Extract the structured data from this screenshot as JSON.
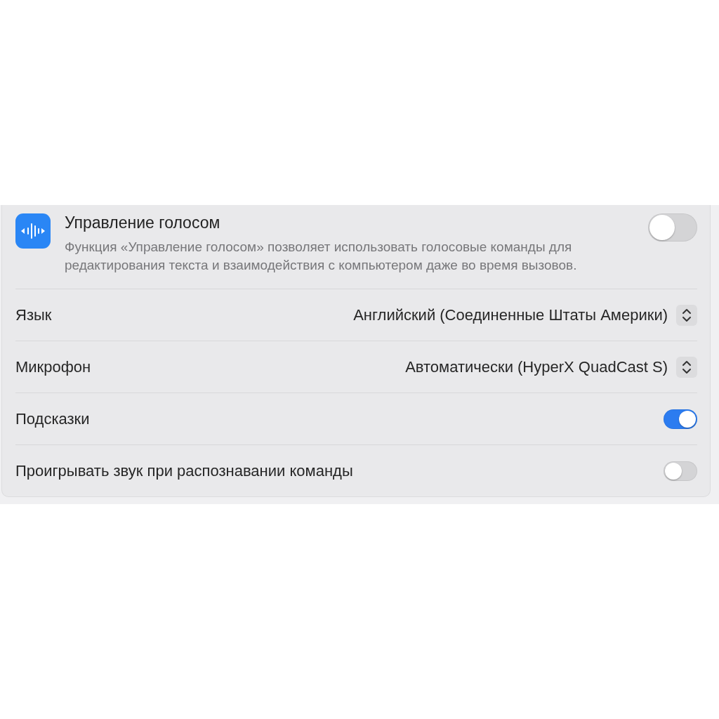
{
  "header": {
    "title": "Управление голосом",
    "description": "Функция «Управление голосом» позволяет использовать голосовые команды для редактирования текста и взаимодействия с компьютером даже во время вызовов.",
    "on": false
  },
  "rows": [
    {
      "kind": "popup",
      "label": "Язык",
      "value": "Английский (Соединенные Штаты Америки)"
    },
    {
      "kind": "popup",
      "label": "Микрофон",
      "value": "Автоматически (HyperX QuadCast S)"
    },
    {
      "kind": "switch",
      "label": "Подсказки",
      "on": true
    },
    {
      "kind": "switch",
      "label": "Проигрывать звук при распознавании команды",
      "on": false
    }
  ]
}
